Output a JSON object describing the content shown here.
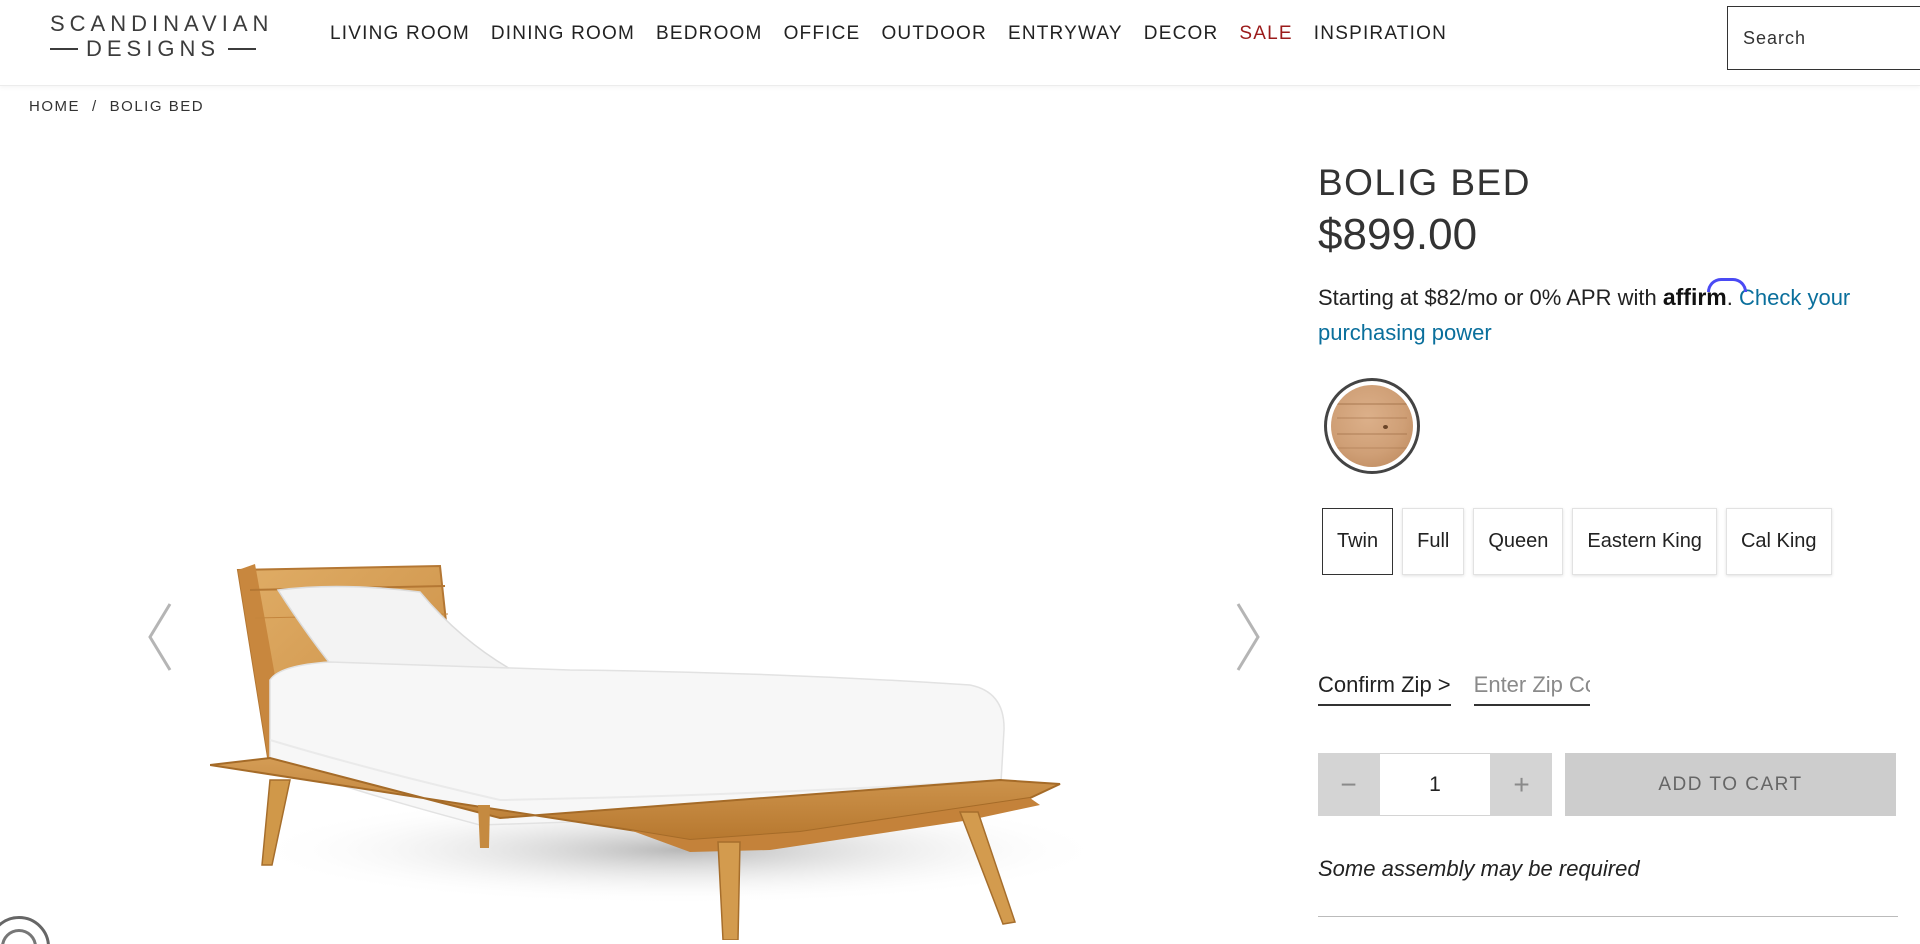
{
  "header": {
    "logo_top": "SCANDINAVIAN",
    "logo_bottom": "DESIGNS",
    "nav": [
      {
        "label": "LIVING ROOM"
      },
      {
        "label": "DINING ROOM"
      },
      {
        "label": "BEDROOM"
      },
      {
        "label": "OFFICE"
      },
      {
        "label": "OUTDOOR"
      },
      {
        "label": "ENTRYWAY"
      },
      {
        "label": "DECOR"
      },
      {
        "label": "SALE"
      },
      {
        "label": "INSPIRATION"
      }
    ],
    "search_placeholder": "Search"
  },
  "breadcrumb": {
    "home": "HOME",
    "separator": "/",
    "current": "BOLIG BED"
  },
  "product": {
    "title": "BOLIG BED",
    "price": "$899.00",
    "financing_prefix": "Starting at $82/mo or 0% APR with ",
    "affirm": "affirm",
    "financing_period": ". ",
    "financing_link": "Check your purchasing power",
    "sizes": [
      "Twin",
      "Full",
      "Queen",
      "Eastern King",
      "Cal King"
    ],
    "selected_size": "Twin",
    "confirm_zip": "Confirm Zip >",
    "zip_placeholder": "Enter Zip Code",
    "qty_minus": "−",
    "quantity": "1",
    "qty_plus": "+",
    "add_to_cart": "ADD TO CART",
    "assembly_note": "Some assembly may be required"
  },
  "colors": {
    "sale": "#9b1b1b",
    "link": "#0a6f9c",
    "wood": "#d19a52",
    "disabled_button": "#cdcdcd"
  }
}
